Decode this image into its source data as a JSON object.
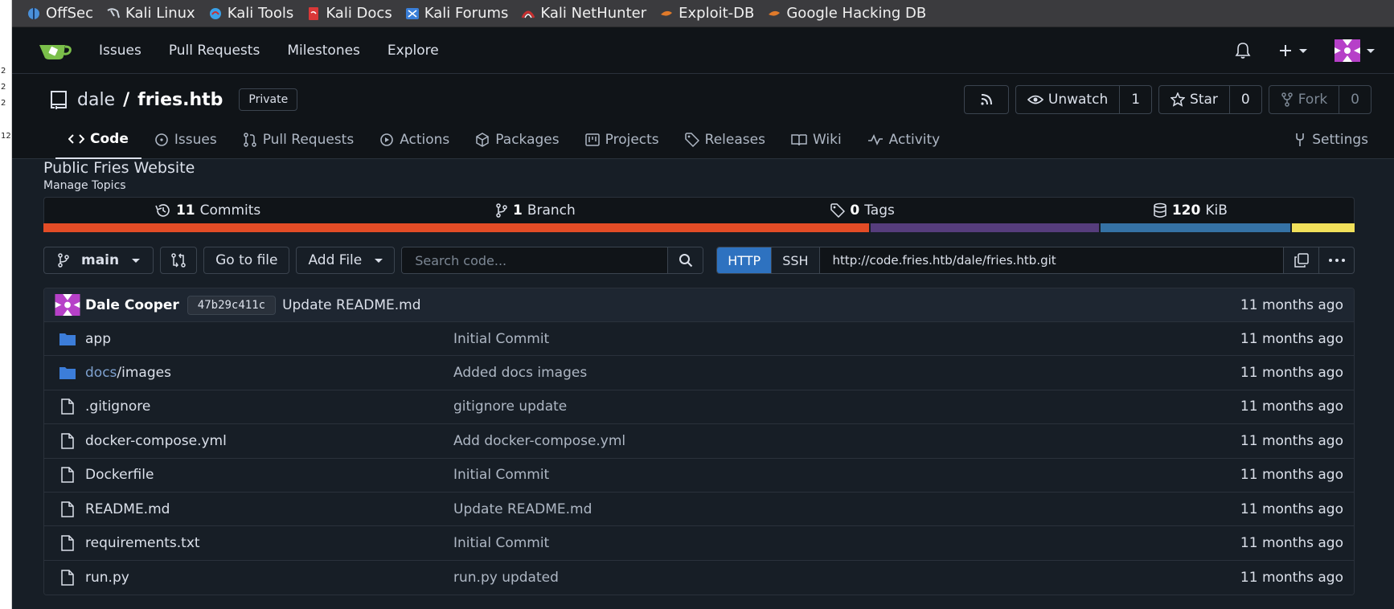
{
  "gutter": [
    "2",
    "2",
    "2",
    "12"
  ],
  "bookmarks": [
    {
      "label": "OffSec",
      "color": "#4a90d9"
    },
    {
      "label": "Kali Linux",
      "color": "#cfd6df"
    },
    {
      "label": "Kali Tools",
      "color": "#3aa0e8"
    },
    {
      "label": "Kali Docs",
      "color": "#d93838"
    },
    {
      "label": "Kali Forums",
      "color": "#3a7fd9"
    },
    {
      "label": "Kali NetHunter",
      "color": "#c83030"
    },
    {
      "label": "Exploit-DB",
      "color": "#e07a2a"
    },
    {
      "label": "Google Hacking DB",
      "color": "#e07a2a"
    }
  ],
  "nav": {
    "links": [
      "Issues",
      "Pull Requests",
      "Milestones",
      "Explore"
    ]
  },
  "repo": {
    "owner": "dale",
    "separator": "/",
    "name": "fries.htb",
    "visibility": "Private",
    "watch_label": "Unwatch",
    "watch_count": "1",
    "star_label": "Star",
    "star_count": "0",
    "fork_label": "Fork",
    "fork_count": "0"
  },
  "tabs": [
    {
      "label": "Code",
      "active": true
    },
    {
      "label": "Issues"
    },
    {
      "label": "Pull Requests"
    },
    {
      "label": "Actions"
    },
    {
      "label": "Packages"
    },
    {
      "label": "Projects"
    },
    {
      "label": "Releases"
    },
    {
      "label": "Wiki"
    },
    {
      "label": "Activity"
    }
  ],
  "settings_label": "Settings",
  "description": "Public Fries Website",
  "manage_topics": "Manage Topics",
  "stats": {
    "commits_count": "11",
    "commits_label": "Commits",
    "branch_count": "1",
    "branch_label": "Branch",
    "tags_count": "0",
    "tags_label": "Tags",
    "size_count": "120",
    "size_label": "KiB"
  },
  "languages": [
    {
      "color": "#e34c26",
      "share": 63.2
    },
    {
      "color": "#563d7c",
      "share": 17.5
    },
    {
      "color": "#3572a5",
      "share": 14.5
    },
    {
      "color": "#f1e05a",
      "share": 4.8
    }
  ],
  "toolbar": {
    "branch": "main",
    "go_to_file": "Go to file",
    "add_file": "Add File",
    "search_placeholder": "Search code...",
    "clone_http": "HTTP",
    "clone_ssh": "SSH",
    "clone_url": "http://code.fries.htb/dale/fries.htb.git"
  },
  "latest_commit": {
    "author": "Dale Cooper",
    "sha": "47b29c411c",
    "message": "Update README.md",
    "age": "11 months ago"
  },
  "files": [
    {
      "type": "folder",
      "name": "app",
      "commit": "Initial Commit",
      "age": "11 months ago"
    },
    {
      "type": "folder",
      "name_dim": "docs",
      "name": "/images",
      "commit": "Added docs images",
      "age": "11 months ago"
    },
    {
      "type": "file",
      "name": ".gitignore",
      "commit": "gitignore update",
      "age": "11 months ago"
    },
    {
      "type": "file",
      "name": "docker-compose.yml",
      "commit": "Add docker-compose.yml",
      "age": "11 months ago"
    },
    {
      "type": "file",
      "name": "Dockerfile",
      "commit": "Initial Commit",
      "age": "11 months ago"
    },
    {
      "type": "file",
      "name": "README.md",
      "commit": "Update README.md",
      "age": "11 months ago"
    },
    {
      "type": "file",
      "name": "requirements.txt",
      "commit": "Initial Commit",
      "age": "11 months ago"
    },
    {
      "type": "file",
      "name": "run.py",
      "commit": "run.py updated",
      "age": "11 months ago"
    }
  ]
}
